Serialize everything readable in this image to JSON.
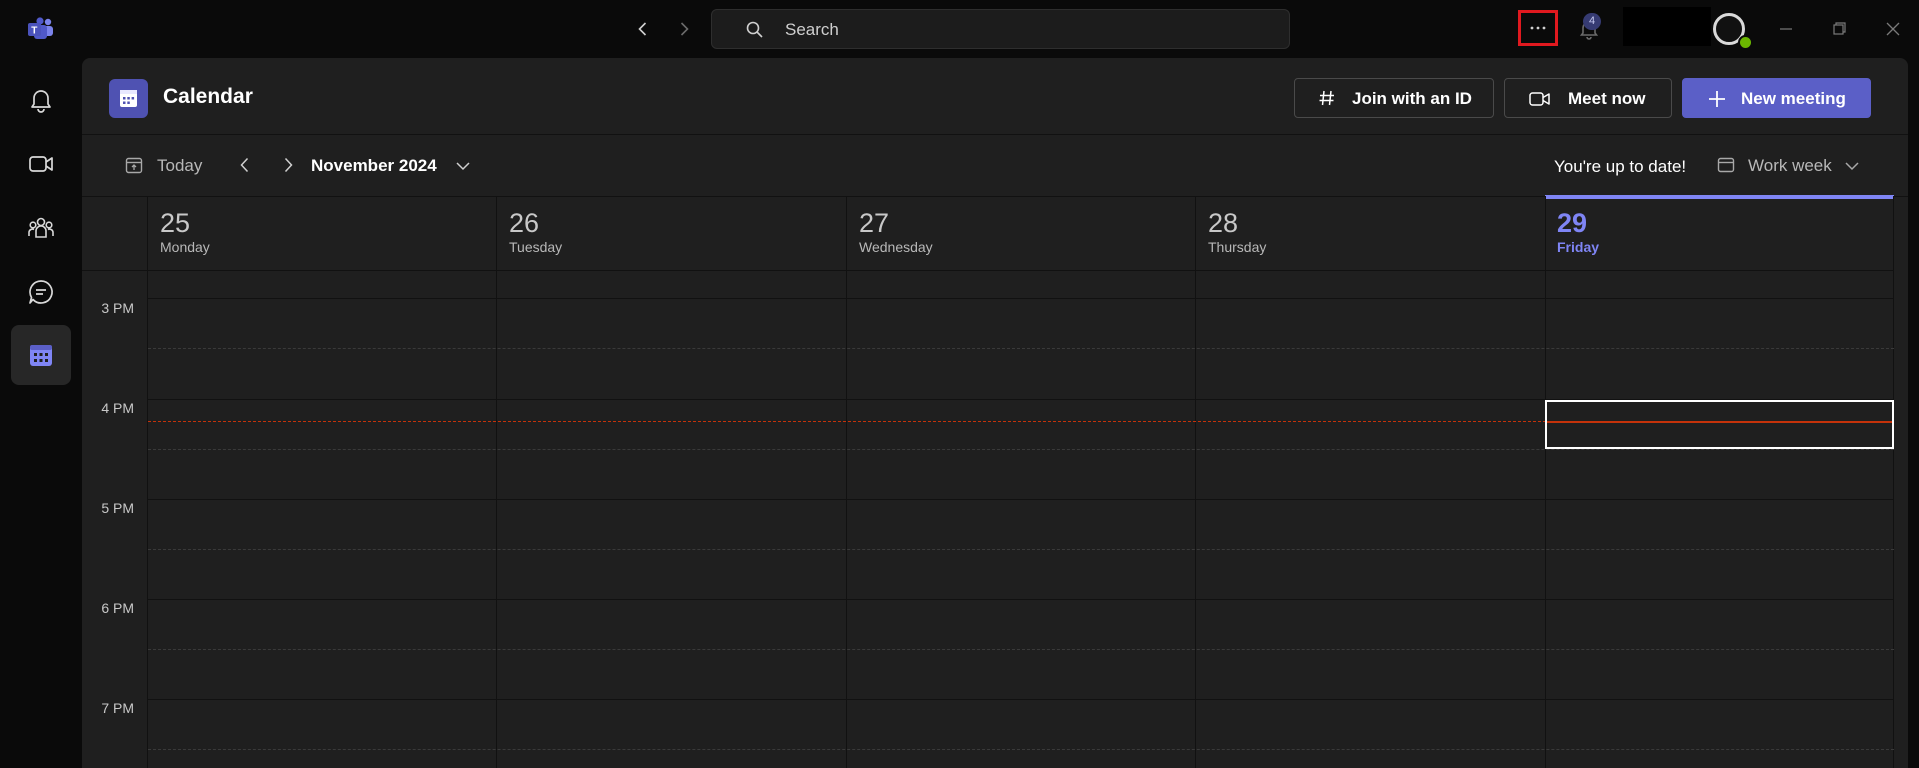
{
  "titlebar": {
    "search_placeholder": "Search",
    "notification_count": "4"
  },
  "rail": {
    "items": [
      {
        "name": "activity",
        "icon": "bell-icon"
      },
      {
        "name": "meet",
        "icon": "video-camera-icon"
      },
      {
        "name": "communities",
        "icon": "people-icon"
      },
      {
        "name": "chat",
        "icon": "chat-bubble-icon"
      },
      {
        "name": "calendar",
        "icon": "calendar-icon",
        "active": true
      }
    ]
  },
  "header": {
    "title": "Calendar",
    "join_label": "Join with an ID",
    "meet_label": "Meet now",
    "new_meeting_label": "New meeting"
  },
  "toolbar": {
    "today_label": "Today",
    "month_label": "November 2024",
    "status_text": "You're up to date!",
    "view_label": "Work week"
  },
  "days": [
    {
      "num": "25",
      "name": "Monday"
    },
    {
      "num": "26",
      "name": "Tuesday"
    },
    {
      "num": "27",
      "name": "Wednesday"
    },
    {
      "num": "28",
      "name": "Thursday"
    },
    {
      "num": "29",
      "name": "Friday",
      "today": true
    }
  ],
  "times": [
    "3 PM",
    "4 PM",
    "5 PM",
    "6 PM",
    "7 PM"
  ],
  "colors": {
    "accent": "#5b5fc7",
    "today_text": "#7f85f5",
    "current_time_line": "#c4320a",
    "highlight_box": "#e0191f"
  }
}
